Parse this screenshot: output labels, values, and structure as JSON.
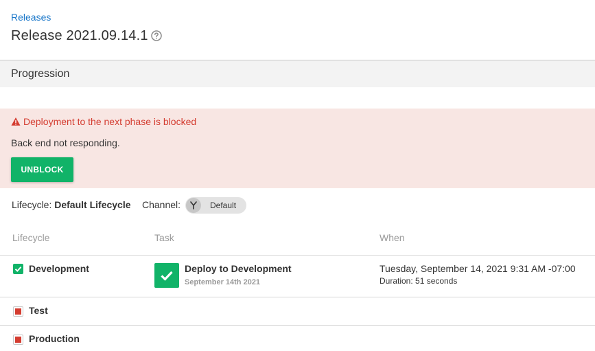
{
  "breadcrumb": {
    "label": "Releases"
  },
  "page": {
    "title": "Release 2021.09.14.1"
  },
  "section": {
    "title": "Progression"
  },
  "alert": {
    "title": "Deployment to the next phase is blocked",
    "message": "Back end not responding.",
    "button_label": "UNBLOCK",
    "color": "#d43c30"
  },
  "meta": {
    "lifecycle_label": "Lifecycle:",
    "lifecycle_value": "Default Lifecycle",
    "channel_label": "Channel:",
    "channel_value": "Default"
  },
  "table": {
    "headers": [
      "Lifecycle",
      "Task",
      "When"
    ],
    "rows": [
      {
        "phase": "Development",
        "status": "complete",
        "task_name": "Deploy to Development",
        "task_date": "September 14th 2021",
        "when": "Tuesday, September 14, 2021 9:31 AM -07:00",
        "duration": "Duration: 51 seconds"
      },
      {
        "phase": "Test",
        "status": "blocked"
      },
      {
        "phase": "Production",
        "status": "blocked"
      }
    ]
  },
  "colors": {
    "accent": "#11b368",
    "link": "#1a77c9",
    "error": "#d43c30"
  }
}
